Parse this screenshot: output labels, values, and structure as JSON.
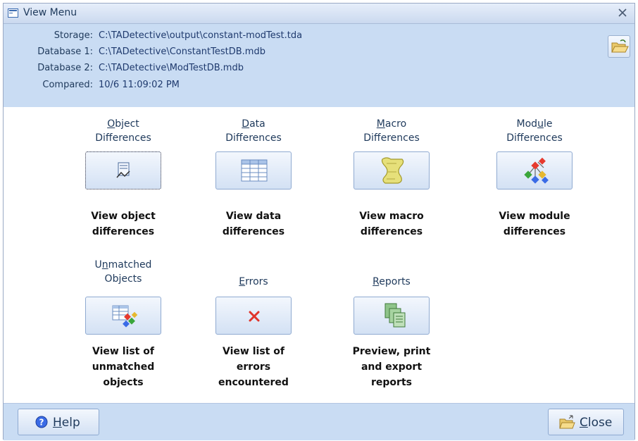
{
  "window": {
    "title": "View Menu",
    "close_glyph": "X"
  },
  "info": {
    "storage_label": "Storage:",
    "storage_value": "C:\\TADetective\\output\\constant-modTest.tda",
    "db1_label": "Database 1:",
    "db1_value": "C:\\TADetective\\ConstantTestDB.mdb",
    "db2_label": "Database 2:",
    "db2_value": "C:\\TADetective\\ModTestDB.mdb",
    "compared_label": "Compared:",
    "compared_value": "10/6 11:09:02 PM",
    "open_icon": "open-folder-icon"
  },
  "items": {
    "object": {
      "cap_before": "",
      "cap_hot": "O",
      "cap_after": "bject",
      "cap_line2": "Differences",
      "desc1": "View object",
      "desc2": "differences",
      "icon": "form-icon"
    },
    "data": {
      "cap_before": "",
      "cap_hot": "D",
      "cap_after": "ata",
      "cap_line2": "Differences",
      "desc1": "View data",
      "desc2": "differences",
      "icon": "datasheet-table-icon"
    },
    "macro": {
      "cap_before": "",
      "cap_hot": "M",
      "cap_after": "acro",
      "cap_line2": "Differences",
      "desc1": "View macro",
      "desc2": "differences",
      "icon": "macro-scroll-icon"
    },
    "module": {
      "cap_before": "Mod",
      "cap_hot": "u",
      "cap_after": "le",
      "cap_line2": "Differences",
      "desc1": "View module",
      "desc2": "differences",
      "icon": "module-diagram-icon"
    },
    "unmatched": {
      "cap_before": "U",
      "cap_hot": "n",
      "cap_after": "matched",
      "cap_line2": "Objects",
      "desc1": "View list of",
      "desc2": "unmatched",
      "desc3": "objects",
      "icon": "unmatched-objects-icon"
    },
    "errors": {
      "cap_before": "",
      "cap_hot": "E",
      "cap_after": "rrors",
      "desc1": "View list of",
      "desc2": "errors",
      "desc3": "encountered",
      "icon": "error-x-icon"
    },
    "reports": {
      "cap_before": "",
      "cap_hot": "R",
      "cap_after": "eports",
      "desc1": "Preview, print",
      "desc2": "and export",
      "desc3": "reports",
      "icon": "reports-icon"
    }
  },
  "footer": {
    "help_hot": "H",
    "help_rest": "elp",
    "help_icon": "help-icon",
    "close_hot": "C",
    "close_rest": "lose",
    "close_icon": "close-folder-icon"
  },
  "colors": {
    "panel_bg": "#c9dcf3",
    "title_text": "#1e395b",
    "button_border": "#8faad1"
  }
}
